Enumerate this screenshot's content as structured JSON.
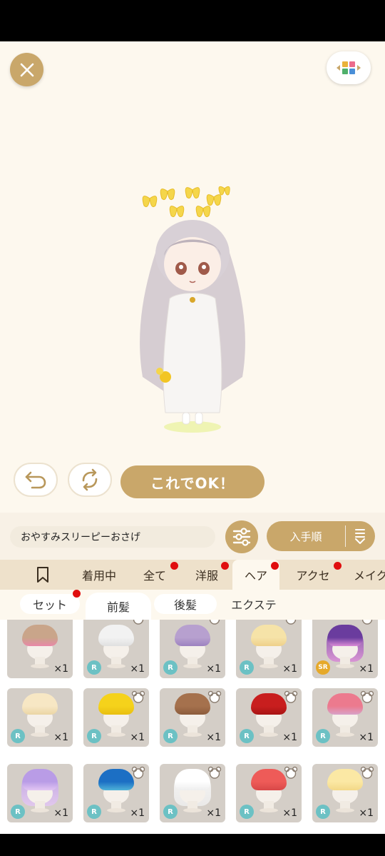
{
  "stage": {
    "close_icon": "close-icon",
    "view_icon": "color-grid-arrows-icon"
  },
  "actions": {
    "undo_icon": "undo-arrow-icon",
    "rotate_icon": "rotate-arrows-icon",
    "ok_label": "これでOK！"
  },
  "toolbar": {
    "set_name": "おやすみスリーピーおさげ",
    "filter_icon": "sliders-icon",
    "sort_label": "入手順",
    "sort_icon": "sort-order-icon"
  },
  "tabs": {
    "bookmark_icon": "bookmark-icon",
    "items": [
      {
        "label": "着用中",
        "badge": false
      },
      {
        "label": "全て",
        "badge": true
      },
      {
        "label": "洋服",
        "badge": true
      },
      {
        "label": "ヘア",
        "badge": true,
        "active": true
      },
      {
        "label": "アクセ",
        "badge": true
      },
      {
        "label": "メイク",
        "badge": false
      }
    ]
  },
  "subtabs": [
    {
      "label": "セット",
      "badge": true
    },
    {
      "label": "前髪",
      "active": true
    },
    {
      "label": "後髪"
    },
    {
      "label": "エクステ"
    }
  ],
  "items": [
    {
      "rarity": "",
      "count": "×1",
      "hair_color": "#c9a58a",
      "accent": "#e888a8",
      "long": false,
      "bear": false
    },
    {
      "rarity": "R",
      "count": "×1",
      "hair_color": "#f2f2f2",
      "accent": "#e0e0e0",
      "long": false,
      "bear": true
    },
    {
      "rarity": "R",
      "count": "×1",
      "hair_color": "#b7a0cf",
      "accent": "#9d82c0",
      "long": false,
      "bear": true
    },
    {
      "rarity": "R",
      "count": "×1",
      "hair_color": "#f6e3a8",
      "accent": "#eed08a",
      "long": false,
      "bear": true
    },
    {
      "rarity": "SR",
      "count": "×1",
      "hair_color": "#6a3c9e",
      "accent": "#d98ad6",
      "long": true,
      "bear": true
    },
    {
      "rarity": "R",
      "count": "×1",
      "hair_color": "#f7e7c4",
      "accent": "#ead5a4",
      "long": false,
      "bear": false
    },
    {
      "rarity": "R",
      "count": "×1",
      "hair_color": "#f5d21b",
      "accent": "#e8bf10",
      "long": false,
      "bear": true
    },
    {
      "rarity": "R",
      "count": "×1",
      "hair_color": "#a5714d",
      "accent": "#8c5c3c",
      "long": false,
      "bear": true
    },
    {
      "rarity": "R",
      "count": "×1",
      "hair_color": "#c81e1e",
      "accent": "#a81414",
      "long": false,
      "bear": true
    },
    {
      "rarity": "R",
      "count": "×1",
      "hair_color": "#ec7a8e",
      "accent": "#d8a2c8",
      "long": false,
      "bear": true
    },
    {
      "rarity": "R",
      "count": "×1",
      "hair_color": "#b99ce6",
      "accent": "#e3c6f3",
      "long": true,
      "bear": false
    },
    {
      "rarity": "R",
      "count": "×1",
      "hair_color": "#1c6fc4",
      "accent": "#4fb2d8",
      "long": false,
      "bear": true
    },
    {
      "rarity": "R",
      "count": "×1",
      "hair_color": "#ffffff",
      "accent": "#eeeeee",
      "long": true,
      "bear": true
    },
    {
      "rarity": "R",
      "count": "×1",
      "hair_color": "#ee5b58",
      "accent": "#d84848",
      "long": false,
      "bear": true
    },
    {
      "rarity": "R",
      "count": "×1",
      "hair_color": "#fbe8a4",
      "accent": "#f3d887",
      "long": false,
      "bear": true
    }
  ],
  "colors": {
    "gold": "#c9a76a",
    "cream": "#fdf8ee",
    "tab_bg": "#eee1cb",
    "badge_red": "#e00e0e",
    "rarity_r": "#6cc1c4",
    "rarity_sr": "#e6a92a"
  }
}
